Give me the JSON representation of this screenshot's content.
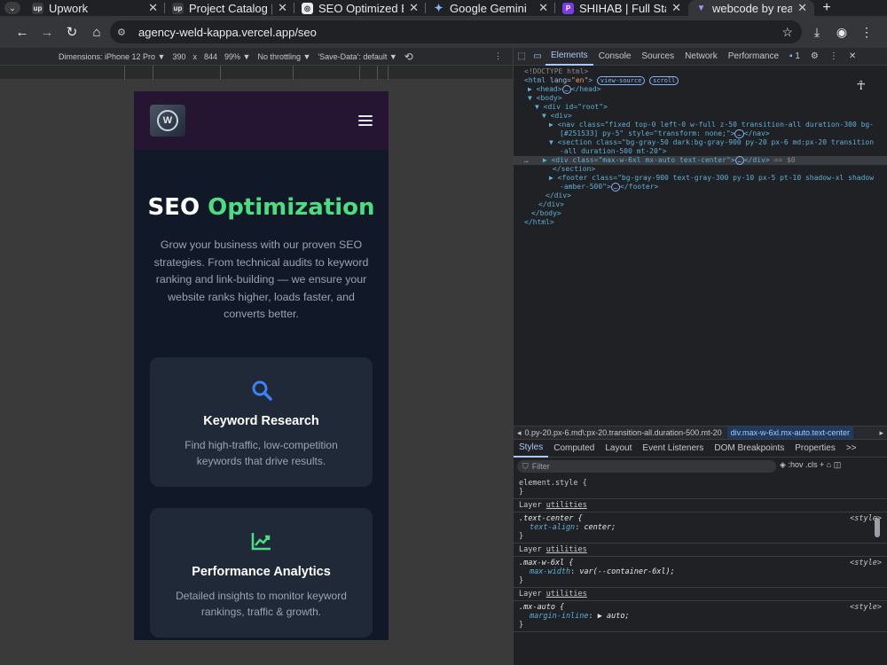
{
  "browser": {
    "tabs": [
      {
        "title": "Upwork",
        "fav": "up",
        "fav_color": "#e8eaed",
        "fav_bg": "#202124"
      },
      {
        "title": "Project Catalog | Up",
        "fav": "up",
        "fav_color": "#e8eaed",
        "fav_bg": "#202124"
      },
      {
        "title": "SEO Optimized Bu",
        "fav": "◎",
        "fav_color": "#202124",
        "fav_bg": "#e8eaed"
      },
      {
        "title": "Google Gemini",
        "fav": "✦",
        "fav_color": "#8ab4f8",
        "fav_bg": "#202124"
      },
      {
        "title": "SHIHAB | Full Stack",
        "fav": "P",
        "fav_color": "#ffffff",
        "fav_bg": "#7c3aed"
      },
      {
        "title": "webcode by react a",
        "fav": "▼",
        "fav_color": "#a78bfa",
        "fav_bg": "#35363a"
      }
    ],
    "url": "agency-weld-kappa.vercel.app/seo"
  },
  "device_toolbar": {
    "dimensions_label": "Dimensions: iPhone 12 Pro ▼",
    "width": "390",
    "times": "x",
    "height": "844",
    "zoom": "99% ▼",
    "throttling": "No throttling ▼",
    "save_data": "'Save-Data': default ▼"
  },
  "page": {
    "title_part1": "SEO ",
    "title_part2": "Optimization",
    "subtitle": "Grow your business with our proven SEO strategies. From technical audits to keyword ranking and link-building — we ensure your website ranks higher, loads faster, and converts better.",
    "cards": [
      {
        "title": "Keyword Research",
        "desc": "Find high-traffic, low-competition keywords that drive results.",
        "icon": "search-icon"
      },
      {
        "title": "Performance Analytics",
        "desc": "Detailed insights to monitor keyword rankings, traffic & growth.",
        "icon": "chart-icon"
      }
    ]
  },
  "devtools": {
    "tabs": [
      "Elements",
      "Console",
      "Sources",
      "Network",
      "Performance"
    ],
    "badge": "1",
    "dom_lines": {
      "l1": "<!DOCTYPE html>",
      "l2_tag": "<html ",
      "l2_attr": "lang=",
      "l2_val": "\"en\"",
      "l2_close": ">",
      "pill1": "view-source",
      "pill2": "scroll",
      "l3": "▶ <head>",
      "l3b": "</head>",
      "l4": "▼ <body>",
      "l5": "▼ <div id=\"root\">",
      "l6": "▼ <div>",
      "l7": "▶ <nav class=\"fixed top-0 left-0 w-full z-50 transition-all duration-300 bg-",
      "l7b": "[#251533] py-5\" style=\"transform: none;\">",
      "l7c": "</nav>",
      "l8": "▼ <section class=\"bg-gray-50 dark:bg-gray-900 py-20 px-6 md:px-20 transition",
      "l8b": "-all duration-500 mt-20\">",
      "l9": "▶ <div class=\"max-w-6xl mx-auto text-center\">",
      "l9b": "</div>",
      "l9c": " == $0",
      "l10": "</section>",
      "l11": "▶ <footer class=\"bg-gray-900 text-gray-300 py-10 px-5 pt-10 shadow-xl shadow",
      "l11b": "-amber-500\">",
      "l11c": "</footer>",
      "l12": "</div>",
      "l13": "</div>",
      "l14": "</body>",
      "l15": "</html>"
    },
    "breadcrumb_1": "0.py-20.px-6.md\\:px-20.transition-all.duration-500.mt-20",
    "breadcrumb_2": "div.max-w-6xl.mx-auto.text-center",
    "style_tabs": [
      "Styles",
      "Computed",
      "Layout",
      "Event Listeners",
      "DOM Breakpoints",
      "Properties",
      ">>"
    ],
    "filter_placeholder": "Filter",
    "filter_tools": ":hov  .cls  +",
    "element_style": "element.style {",
    "close_brace": "}",
    "layer_label": "Layer ",
    "layer_link": "utilities",
    "rules": [
      {
        "selector": ".text-center {",
        "source": "<style>",
        "prop": "text-align",
        "value": "center;"
      },
      {
        "selector": ".max-w-6xl {",
        "source": "<style>",
        "prop": "max-width",
        "value": "var(--container-6xl);"
      },
      {
        "selector": ".mx-auto {",
        "source": "<style>",
        "prop": "margin-inline",
        "value": "▶ auto;"
      }
    ]
  }
}
